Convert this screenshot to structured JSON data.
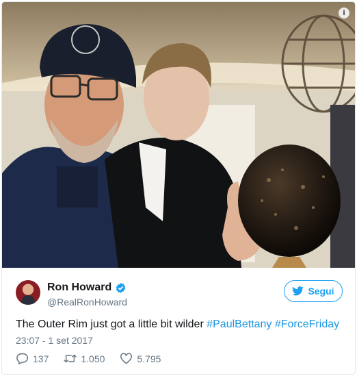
{
  "photo": {
    "info_icon": "info-icon",
    "description_icon": "photo-illustration"
  },
  "tweet": {
    "author": {
      "display_name": "Ron Howard",
      "handle": "@RealRonHoward",
      "verified_icon": "verified-badge-icon"
    },
    "follow": {
      "label": "Segui",
      "icon": "twitter-bird-icon"
    },
    "text": {
      "plain": "The Outer Rim just got a little bit wilder ",
      "hashtag_1": "#PaulBettany",
      "hashtag_2": "#ForceFriday"
    },
    "timestamp": "23:07 - 1 set 2017",
    "actions": {
      "replies": "137",
      "retweets": "1.050",
      "likes": "5.795"
    }
  },
  "colors": {
    "accent": "#1da1f2",
    "hashtag": "#1b95e0",
    "muted": "#657786",
    "text": "#14171a"
  }
}
